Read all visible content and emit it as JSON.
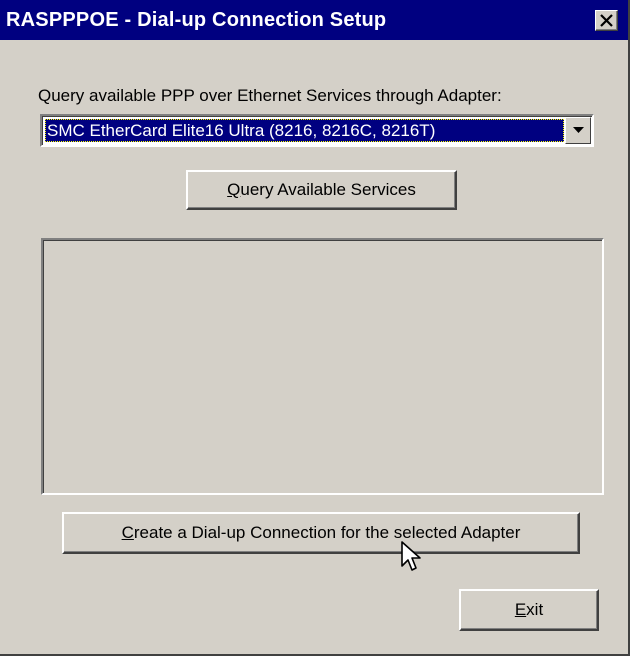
{
  "window": {
    "title": "RASPPPOE - Dial-up Connection Setup",
    "close_icon": "close-icon"
  },
  "main": {
    "prompt": "Query available PPP over Ethernet Services through Adapter:",
    "adapter_select": {
      "selected": "SMC EtherCard Elite16 Ultra (8216, 8216C, 8216T)",
      "arrow_icon": "chevron-down-icon"
    },
    "query_button": {
      "accel": "Q",
      "rest": "uery Available Services"
    },
    "services_list": {
      "items": []
    },
    "create_button": {
      "accel": "C",
      "rest": "reate a Dial-up Connection for the selected Adapter"
    },
    "exit_button": {
      "accel": "E",
      "rest": "xit"
    }
  },
  "colors": {
    "titlebar": "#000080",
    "face": "#d4d0c8",
    "selection": "#000080"
  }
}
